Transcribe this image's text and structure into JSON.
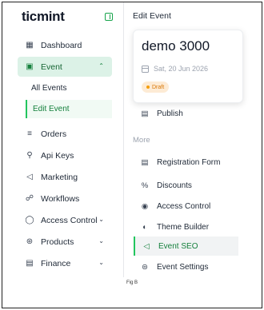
{
  "sidebar": {
    "brand": "ticmint",
    "items": [
      {
        "label": "Dashboard",
        "icon": "dashboard-icon"
      },
      {
        "label": "Event",
        "icon": "calendar-icon",
        "expanded": true
      },
      {
        "label": "Orders",
        "icon": "orders-icon"
      },
      {
        "label": "Api Keys",
        "icon": "key-icon"
      },
      {
        "label": "Marketing",
        "icon": "megaphone-icon"
      },
      {
        "label": "Workflows",
        "icon": "workflow-icon"
      },
      {
        "label": "Access Control",
        "icon": "globe-icon"
      },
      {
        "label": "Products",
        "icon": "cart-icon"
      },
      {
        "label": "Finance",
        "icon": "finance-icon"
      }
    ],
    "subitems": [
      {
        "label": "All Events"
      },
      {
        "label": "Edit Event",
        "active": true
      }
    ]
  },
  "panel": {
    "title": "Edit Event",
    "card": {
      "event_name": "demo 3000",
      "date": "Sat, 20 Jun 2026",
      "status": "Draft"
    },
    "items": [
      {
        "label": "Publish",
        "icon": "publish-icon"
      }
    ],
    "section_label": "More",
    "more_items": [
      {
        "label": "Registration Form",
        "icon": "form-icon"
      },
      {
        "label": "Discounts",
        "icon": "percent-icon"
      },
      {
        "label": "Access Control",
        "icon": "shield-icon"
      },
      {
        "label": "Theme Builder",
        "icon": "palette-icon"
      },
      {
        "label": "Event SEO",
        "icon": "megaphone-icon",
        "active": true
      },
      {
        "label": "Event Settings",
        "icon": "settings-sliders-icon"
      }
    ]
  },
  "caption": "Fig B",
  "colors": {
    "accent": "#16a34a",
    "active_bg": "#dcf2e7",
    "draft_bg": "#fdebd5",
    "draft_text": "#d97706"
  }
}
